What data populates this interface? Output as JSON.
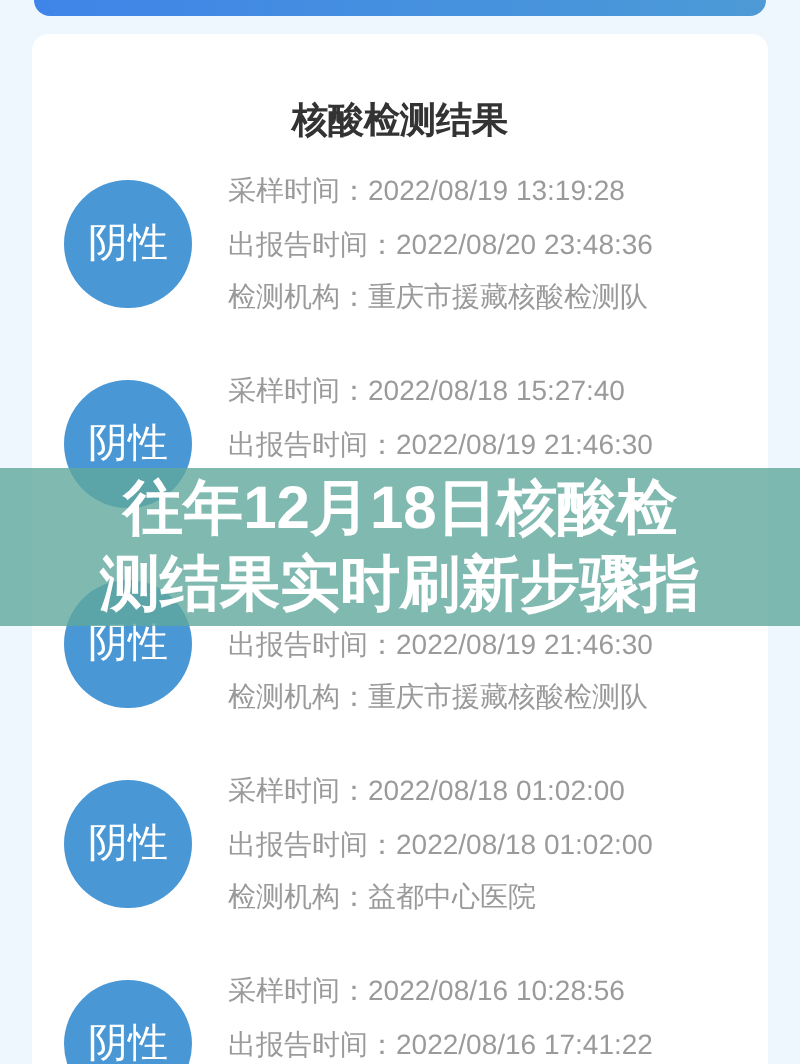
{
  "card": {
    "title": "核酸检测结果"
  },
  "records": [
    {
      "result": "阴性",
      "sample": {
        "label": "采样时间：",
        "value": "2022/08/19 13:19:28"
      },
      "report": {
        "label": "出报告时间：",
        "value": "2022/08/20 23:48:36"
      },
      "institution": {
        "label": "检测机构：",
        "value": "重庆市援藏核酸检测队"
      }
    },
    {
      "result": "阴性",
      "sample": {
        "label": "采样时间：",
        "value": "2022/08/18 15:27:40"
      },
      "report": {
        "label": "出报告时间：",
        "value": "2022/08/19 21:46:30"
      }
    },
    {
      "result": "阴性",
      "report": {
        "label": "出报告时间：",
        "value": "2022/08/19 21:46:30"
      },
      "institution": {
        "label": "检测机构：",
        "value": "重庆市援藏核酸检测队"
      }
    },
    {
      "result": "阴性",
      "sample": {
        "label": "采样时间：",
        "value": "2022/08/18 01:02:00"
      },
      "report": {
        "label": "出报告时间：",
        "value": "2022/08/18 01:02:00"
      },
      "institution": {
        "label": "检测机构：",
        "value": "益都中心医院"
      }
    },
    {
      "result": "阴性",
      "sample": {
        "label": "采样时间：",
        "value": "2022/08/16 10:28:56"
      },
      "report": {
        "label": "出报告时间：",
        "value": "2022/08/16 17:41:22"
      }
    }
  ],
  "headline": "往年12月18日核酸检测结果实时刷新步骤指"
}
